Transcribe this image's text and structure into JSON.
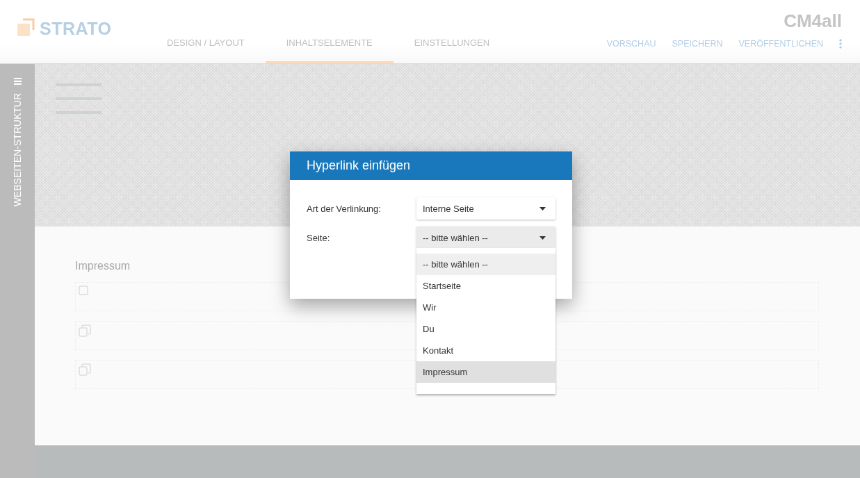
{
  "header": {
    "logo": "STRATO",
    "brand": "CM4all",
    "tabs": [
      {
        "label": "DESIGN / LAYOUT",
        "selected": false
      },
      {
        "label": "INHALTSELEMENTE",
        "selected": true
      },
      {
        "label": "EINSTELLUNGEN",
        "selected": false
      }
    ],
    "actions": [
      "VORSCHAU",
      "SPEICHERN",
      "VERÖFFENTLICHEN"
    ]
  },
  "sidebar": {
    "label": "WEBSEITEN-STRUKTUR"
  },
  "canvas": {
    "heading": "Impressum"
  },
  "dialog": {
    "title": "Hyperlink einfügen",
    "fields": [
      {
        "label": "Art der Verlinkung:",
        "value": "Interne Seite",
        "open": false
      },
      {
        "label": "Seite:",
        "value": "-- bitte wählen --",
        "open": true
      }
    ],
    "options": [
      {
        "label": "-- bitte wählen --",
        "selected": true,
        "hovered": false
      },
      {
        "label": "Startseite",
        "selected": false,
        "hovered": false
      },
      {
        "label": "Wir",
        "selected": false,
        "hovered": false
      },
      {
        "label": "Du",
        "selected": false,
        "hovered": false
      },
      {
        "label": "Kontakt",
        "selected": false,
        "hovered": false
      },
      {
        "label": "Impressum",
        "selected": false,
        "hovered": true
      }
    ]
  }
}
